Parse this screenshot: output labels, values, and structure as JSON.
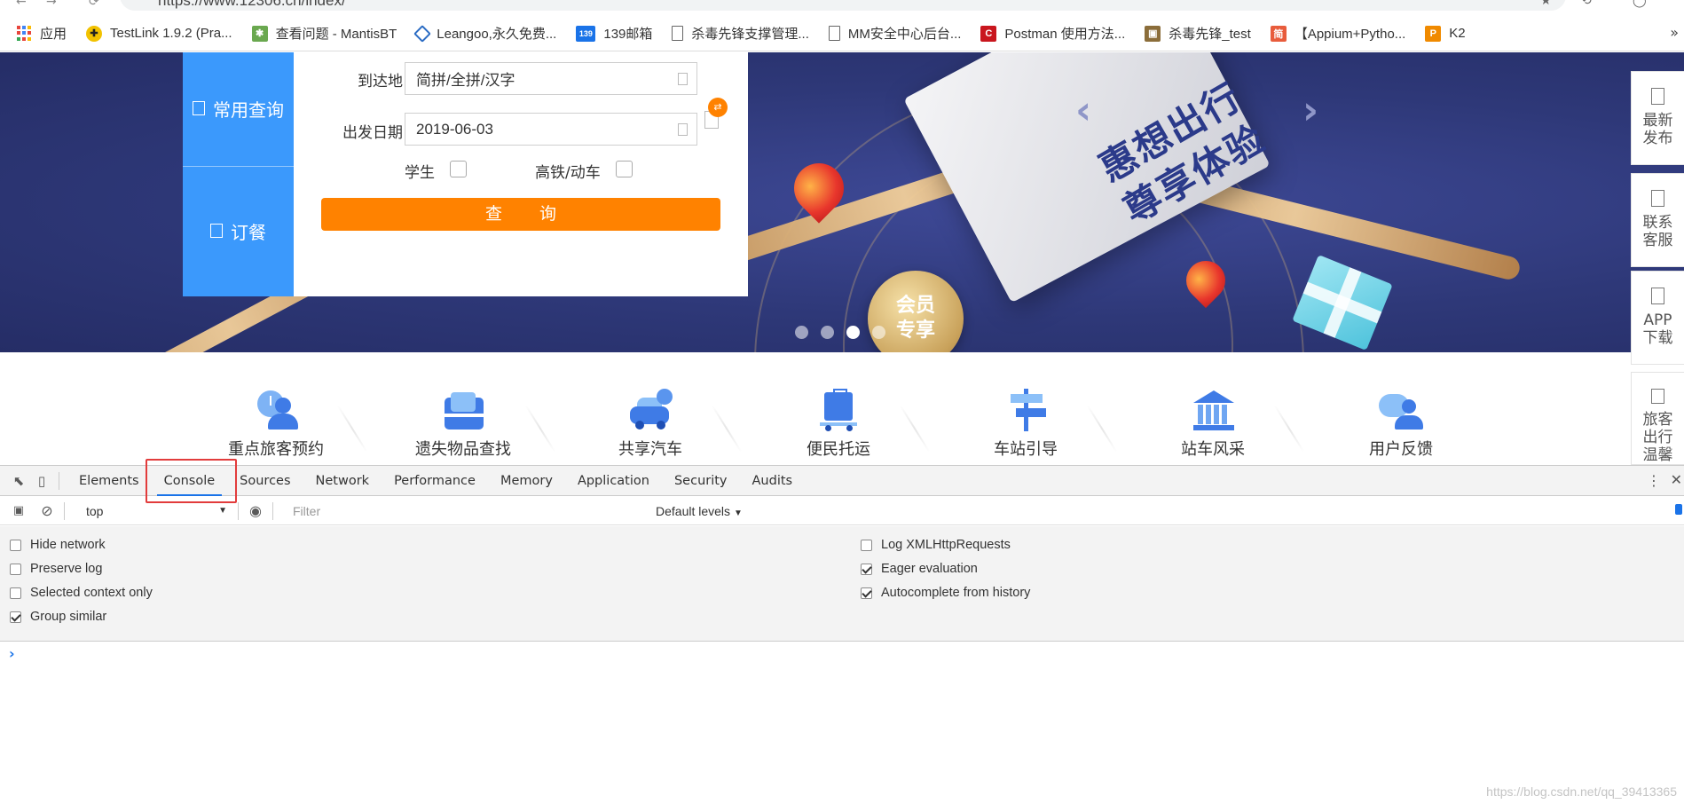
{
  "browser": {
    "address_url": "https://www.12306.cn/index/"
  },
  "bookmarks": [
    {
      "label": "应用",
      "icon": "apps-grid-icon"
    },
    {
      "label": "TestLink 1.9.2 (Pra...",
      "icon": "testlink-icon",
      "color": "#f2c200"
    },
    {
      "label": "查看问题 - MantisBT",
      "icon": "mantis-icon",
      "color": "#6aa84f"
    },
    {
      "label": "Leangoo,永久免费...",
      "icon": "leangoo-icon",
      "color": "#2b6cc4"
    },
    {
      "label": "139邮箱",
      "icon": "mail139-icon",
      "color": "#1a73e8"
    },
    {
      "label": "杀毒先锋支撑管理...",
      "icon": "document-icon"
    },
    {
      "label": "MM安全中心后台...",
      "icon": "document-icon"
    },
    {
      "label": "Postman 使用方法...",
      "icon": "csdn-icon",
      "color": "#c9161e"
    },
    {
      "label": "杀毒先锋_test",
      "icon": "image-icon",
      "color": "#8b6d3a"
    },
    {
      "label": "【Appium+Pytho...",
      "icon": "jianshu-icon",
      "color": "#e85c3c"
    },
    {
      "label": "K2",
      "icon": "k2-icon",
      "color": "#f08a00"
    }
  ],
  "search_panel": {
    "tabs": [
      {
        "label": "常用查询"
      },
      {
        "label": "订餐"
      }
    ],
    "arrival_label": "到达地",
    "arrival_placeholder": "简拼/全拼/汉字",
    "date_label": "出发日期",
    "date_value": "2019-06-03",
    "student_label": "学生",
    "highspeed_label": "高铁/动车",
    "query_label": "查 询"
  },
  "banner": {
    "slogan_line1": "惠想出行",
    "slogan_line2": "尊享体验",
    "medal_line1": "会员",
    "medal_line2": "专享",
    "slides": 4,
    "active_slide": 3
  },
  "side_toolbar": [
    {
      "label": "最新发布"
    },
    {
      "label": "联系客服"
    },
    {
      "label": "APP下载"
    },
    {
      "label": "旅客出行温馨"
    }
  ],
  "services": [
    {
      "label": "重点旅客预约",
      "icon": "passenger-clock-icon"
    },
    {
      "label": "遗失物品查找",
      "icon": "lost-bag-icon"
    },
    {
      "label": "共享汽车",
      "icon": "shared-car-icon"
    },
    {
      "label": "便民托运",
      "icon": "luggage-cart-icon"
    },
    {
      "label": "车站引导",
      "icon": "signpost-icon"
    },
    {
      "label": "站车风采",
      "icon": "station-building-icon"
    },
    {
      "label": "用户反馈",
      "icon": "feedback-chat-icon"
    }
  ],
  "devtools": {
    "tabs": [
      "Elements",
      "Console",
      "Sources",
      "Network",
      "Performance",
      "Memory",
      "Application",
      "Security",
      "Audits"
    ],
    "active_tab": "Console",
    "context": "top",
    "filter_placeholder": "Filter",
    "levels": "Default levels",
    "settings_left": [
      {
        "label": "Hide network",
        "checked": false
      },
      {
        "label": "Preserve log",
        "checked": false
      },
      {
        "label": "Selected context only",
        "checked": false
      },
      {
        "label": "Group similar",
        "checked": true
      }
    ],
    "settings_right": [
      {
        "label": "Log XMLHttpRequests",
        "checked": false
      },
      {
        "label": "Eager evaluation",
        "checked": true
      },
      {
        "label": "Autocomplete from history",
        "checked": true
      }
    ],
    "prompt": "›"
  },
  "watermark": "https://blog.csdn.net/qq_39413365",
  "colors": {
    "brand_blue": "#3b99fc",
    "query_orange": "#ff8200",
    "devtools_accent": "#1a73e8",
    "highlight_red": "#e23c3c"
  }
}
